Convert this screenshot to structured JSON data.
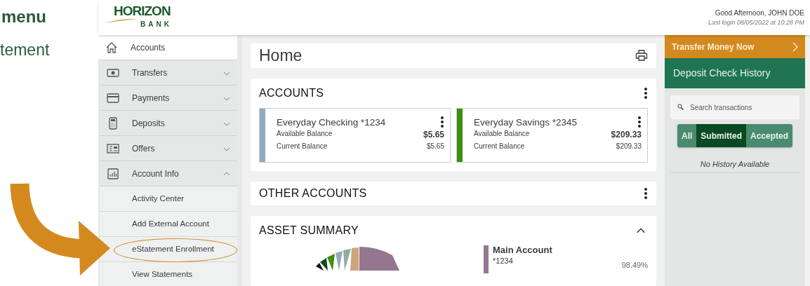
{
  "annotation": {
    "heading": "menu",
    "subheading": "tement"
  },
  "header": {
    "greeting": "Good Afternoon, JOHN DOE",
    "last_login": "Last login 08/05/2022 at 10:28 PM",
    "logo_name": "HORIZON",
    "logo_sub": "BANK"
  },
  "sidebar": {
    "items": [
      {
        "label": "Accounts",
        "selected": true
      },
      {
        "label": "Transfers",
        "selected": false,
        "expanded": false
      },
      {
        "label": "Payments",
        "selected": false,
        "expanded": false
      },
      {
        "label": "Deposits",
        "selected": false,
        "expanded": false
      },
      {
        "label": "Offers",
        "selected": false,
        "expanded": false
      },
      {
        "label": "Account Info",
        "selected": false,
        "expanded": true,
        "children": [
          {
            "label": "Activity Center",
            "circled": false
          },
          {
            "label": "Add External Account",
            "circled": false
          },
          {
            "label": "eStatement Enrollment",
            "circled": true
          },
          {
            "label": "View Statements",
            "circled": false
          }
        ]
      }
    ]
  },
  "main": {
    "page_title": "Home",
    "accounts": {
      "title": "ACCOUNTS",
      "items": [
        {
          "name": "Everyday Checking *1234",
          "color": "#8eabc0",
          "available_label": "Available Balance",
          "available": "$5.65",
          "current_label": "Current Balance",
          "current": "$5.65"
        },
        {
          "name": "Everyday Savings *2345",
          "color": "#3d8f0f",
          "available_label": "Available Balance",
          "available": "$209.33",
          "current_label": "Current Balance",
          "current": "$209.33"
        }
      ]
    },
    "other_accounts": {
      "title": "OTHER ACCOUNTS"
    },
    "asset_summary": {
      "title": "ASSET SUMMARY",
      "expanded": true,
      "legend": [
        {
          "name": "Main Account",
          "number": "*1234",
          "percent": "98.49%",
          "color": "#94778f"
        }
      ]
    }
  },
  "right_panel": {
    "transfer_button": "Transfer Money Now",
    "history_title": "Deposit Check History",
    "search": {
      "placeholder": "Search transactions"
    },
    "filters": [
      {
        "label": "All",
        "selected": false
      },
      {
        "label": "Submitted",
        "selected": true
      },
      {
        "label": "Accepted",
        "selected": false
      }
    ],
    "empty_message": "No History Available"
  }
}
